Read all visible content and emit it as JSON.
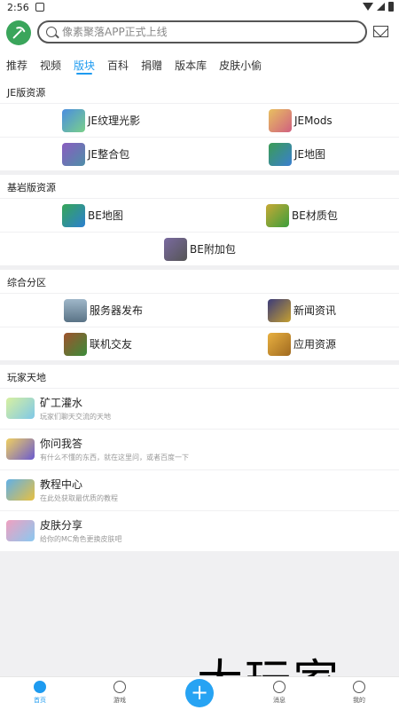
{
  "status": {
    "time": "2:56"
  },
  "search": {
    "placeholder": "像素聚落APP正式上线"
  },
  "tabs": [
    "推荐",
    "视频",
    "版块",
    "百科",
    "捐赠",
    "版本库",
    "皮肤小偷"
  ],
  "sections": {
    "je": {
      "title": "JE版资源",
      "items": [
        "JE纹理光影",
        "JEMods",
        "JE整合包",
        "JE地图"
      ]
    },
    "be": {
      "title": "基岩版资源",
      "items": [
        "BE地图",
        "BE材质包",
        "BE附加包"
      ]
    },
    "zh": {
      "title": "综合分区",
      "items": [
        "服务器发布",
        "新闻资讯",
        "联机交友",
        "应用资源"
      ]
    },
    "wj": {
      "title": "玩家天地",
      "items": [
        {
          "title": "矿工灌水",
          "sub": "玩家们聊天交流的天地"
        },
        {
          "title": "你问我答",
          "sub": "有什么不懂的东西，就在这里问，或者百度一下"
        },
        {
          "title": "教程中心",
          "sub": "在此处获取最优质的教程"
        },
        {
          "title": "皮肤分享",
          "sub": "给你的MC角色更换皮肤吧"
        }
      ]
    }
  },
  "nav": {
    "home": "首页",
    "games": "游戏",
    "msg": "消息",
    "me": "我的",
    "fab": "+"
  },
  "watermark": "大玩家",
  "colors": {
    "accent": "#1e9bf0",
    "fab": "#27a3f3"
  }
}
